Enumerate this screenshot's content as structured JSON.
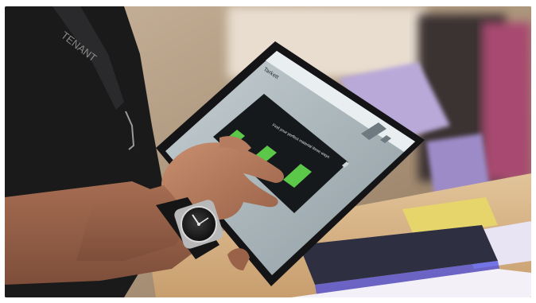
{
  "photo": {
    "lanyard_text": "TENANT",
    "tablet_brand_text": "Tarkett",
    "tablet_nav_label": "",
    "dialog_heading": "Find your perfect material three ways",
    "dialog_cta_label": "",
    "colors": {
      "shirt": "#1a1a1a",
      "skin": "#b07a5e",
      "tablet_bezel": "#141416",
      "screen_bg": "#aeb9bd",
      "dialog_bg": "#16191b",
      "accent_green": "#5cc84a",
      "sample_purple": "#b9a9d9",
      "sample_yellow": "#e6d56b",
      "table_wood": "#d8b487"
    },
    "icons": [
      "wristwatch-icon",
      "lanyard-icon"
    ]
  }
}
